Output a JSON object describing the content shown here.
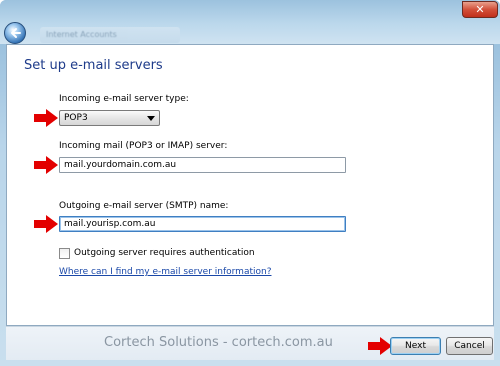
{
  "window": {
    "title": "Internet Accounts",
    "close_glyph": "✕"
  },
  "heading": "Set up e-mail servers",
  "incoming_type": {
    "label": "Incoming e-mail server type:",
    "selected": "POP3"
  },
  "incoming_server": {
    "label": "Incoming mail (POP3 or IMAP) server:",
    "value": "mail.yourdomain.com.au"
  },
  "outgoing_server": {
    "label": "Outgoing e-mail server (SMTP) name:",
    "value": "mail.yourisp.com.au"
  },
  "auth_checkbox": {
    "label": "Outgoing server requires authentication",
    "checked": false
  },
  "help_link": "Where can I find my e-mail server information?",
  "watermark": "Cortech Solutions - cortech.com.au",
  "buttons": {
    "next": "Next",
    "cancel": "Cancel"
  },
  "colors": {
    "heading": "#1e3b8a",
    "link": "#1a48a8",
    "arrow": "#e30000"
  },
  "icons": {
    "back": "back-arrow-icon",
    "marker": "red-arrow-icon"
  }
}
